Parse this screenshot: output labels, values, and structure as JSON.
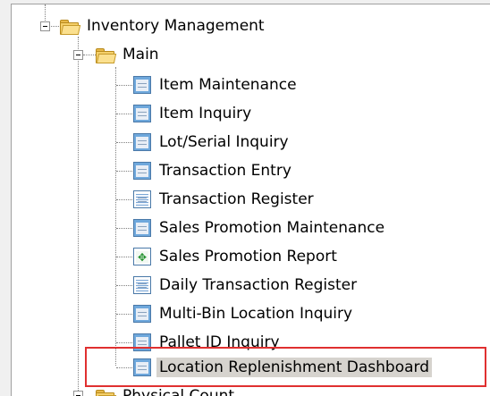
{
  "tree": {
    "root": {
      "label": "Inventory Management"
    },
    "main": {
      "label": "Main"
    },
    "items": [
      {
        "label": "Item Maintenance",
        "icon": "program-icon"
      },
      {
        "label": "Item Inquiry",
        "icon": "program-icon"
      },
      {
        "label": "Lot/Serial Inquiry",
        "icon": "program-icon"
      },
      {
        "label": "Transaction Entry",
        "icon": "program-icon"
      },
      {
        "label": "Transaction Register",
        "icon": "register-icon"
      },
      {
        "label": "Sales Promotion Maintenance",
        "icon": "program-icon"
      },
      {
        "label": "Sales Promotion Report",
        "icon": "report-icon"
      },
      {
        "label": "Daily Transaction Register",
        "icon": "register-icon"
      },
      {
        "label": "Multi-Bin Location Inquiry",
        "icon": "program-icon"
      },
      {
        "label": "Pallet ID Inquiry",
        "icon": "program-icon"
      },
      {
        "label": "Location Replenishment Dashboard",
        "icon": "program-icon",
        "selected": true
      }
    ],
    "next_folder": {
      "label": "Physical Count"
    }
  },
  "colors": {
    "highlight_border": "#e03030",
    "selection_background": "#d6d3ce"
  }
}
